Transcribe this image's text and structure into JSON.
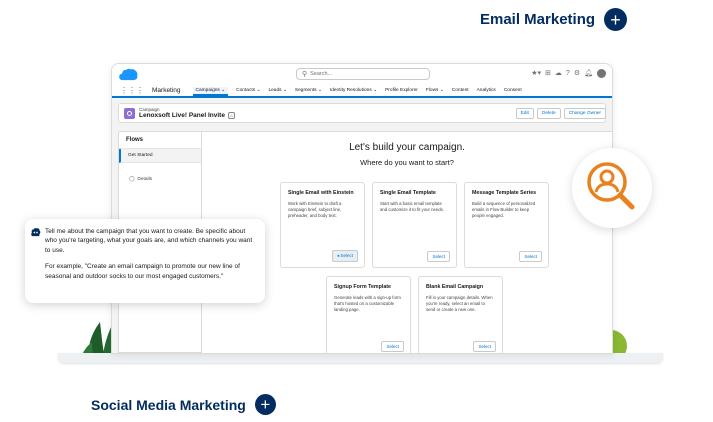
{
  "headings": {
    "email_marketing": "Email Marketing",
    "social_media_marketing": "Social Media Marketing"
  },
  "header": {
    "search_placeholder": "Search..."
  },
  "nav": {
    "app_name": "Marketing",
    "items": [
      "Campaigns",
      "Contacts",
      "Leads",
      "Segments",
      "Identity Resolutions",
      "Profile Explorer",
      "Flows",
      "Content",
      "Analytics",
      "Consent"
    ]
  },
  "record": {
    "type": "Campaign",
    "name": "Lenoxsoft Live! Panel Invite",
    "actions": [
      "Edit",
      "Delete",
      "Change Owner"
    ]
  },
  "flows_panel": {
    "title": "Flows",
    "active_item": "Get Started",
    "details": "Details"
  },
  "builder": {
    "title": "Let's build your campaign.",
    "subtitle": "Where do you want to start?",
    "cards": [
      {
        "title": "Single Email with Einstein",
        "desc": "Work with Einstein to draft a campaign brief, subject line, preheader, and body text.",
        "select": "Select"
      },
      {
        "title": "Single Email Template",
        "desc": "Start with a basic email template and customize it to fit your needs.",
        "select": "Select"
      },
      {
        "title": "Message Template Series",
        "desc": "Build a sequence of personalized emails in Flow Builder to keep people engaged.",
        "select": "Select"
      },
      {
        "title": "Signup Form Template",
        "desc": "Generate leads with a sign-up form that's hosted on a customizable landing page.",
        "select": "Select"
      },
      {
        "title": "Blank Email Campaign",
        "desc": "Fill in your campaign details. When you're ready, select an email to send or create a new one.",
        "select": "Select"
      }
    ]
  },
  "chat": {
    "message": "Tell me about the campaign that you want to create. Be specific about who you're targeting, what your goals are, and which channels you want to use.",
    "example": "For example, \"Create an email campaign to promote our new line of seasonal and outdoor socks to our most engaged customers.\""
  },
  "colors": {
    "brand_navy": "#032d60",
    "salesforce_blue": "#0176d3",
    "magnifier_orange": "#e8821e"
  }
}
